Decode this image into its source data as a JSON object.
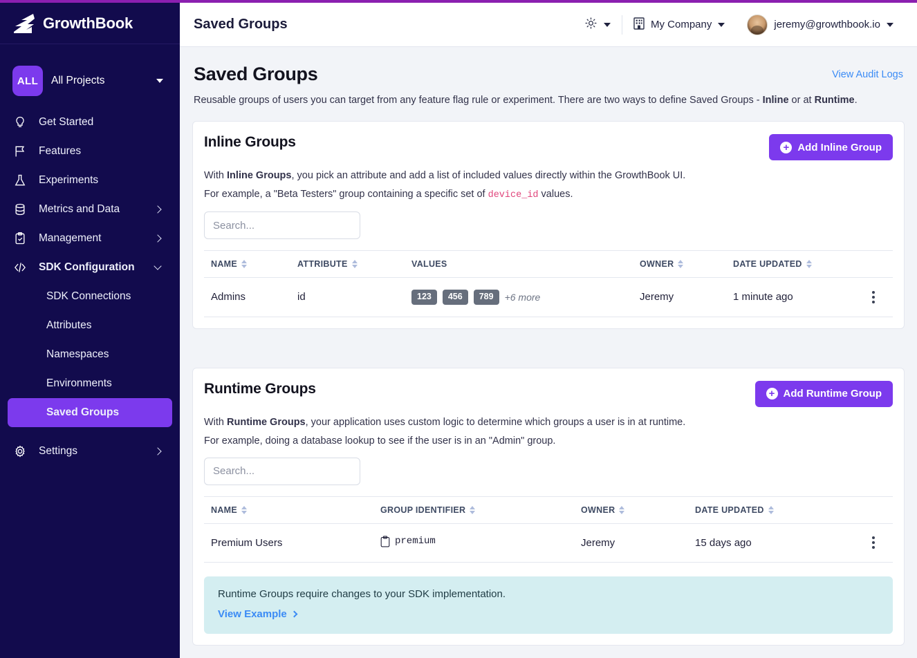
{
  "brand": {
    "name": "GrowthBook",
    "logo_icon": "growthbook-logo-icon"
  },
  "sidebar": {
    "project": {
      "badge": "ALL",
      "label": "All Projects",
      "caret_icon": "caret-down-icon"
    },
    "items": [
      {
        "label": "Get Started",
        "icon": "lightbulb-icon",
        "expandable": false
      },
      {
        "label": "Features",
        "icon": "flag-icon",
        "expandable": false
      },
      {
        "label": "Experiments",
        "icon": "flask-icon",
        "expandable": false
      },
      {
        "label": "Metrics and Data",
        "icon": "database-icon",
        "expandable": true
      },
      {
        "label": "Management",
        "icon": "clipboard-check-icon",
        "expandable": true
      },
      {
        "label": "SDK Configuration",
        "icon": "code-brackets-icon",
        "expandable": true,
        "expanded": true
      }
    ],
    "sub_items": [
      {
        "label": "SDK Connections",
        "active": false
      },
      {
        "label": "Attributes",
        "active": false
      },
      {
        "label": "Namespaces",
        "active": false
      },
      {
        "label": "Environments",
        "active": false
      },
      {
        "label": "Saved Groups",
        "active": true
      }
    ],
    "settings": {
      "label": "Settings",
      "icon": "gear-icon",
      "expandable": true
    }
  },
  "topbar": {
    "title": "Saved Groups",
    "theme_toggle": "sun-icon",
    "org": {
      "label": "My Company",
      "icon": "building-icon"
    },
    "user": {
      "email": "jeremy@growthbook.io",
      "avatar": "user-avatar"
    }
  },
  "page": {
    "title": "Saved Groups",
    "audit_link": "View Audit Logs",
    "description_parts": {
      "p1": "Reusable groups of users you can target from any feature flag rule or experiment. There are two ways to define Saved Groups - ",
      "b1": "Inline",
      "p2": " or at ",
      "b2": "Runtime",
      "p3": "."
    }
  },
  "inline_groups": {
    "title": "Inline Groups",
    "add_button": "Add Inline Group",
    "desc1_parts": {
      "a": "With ",
      "b": "Inline Groups",
      "c": ", you pick an attribute and add a list of included values directly within the GrowthBook UI."
    },
    "desc2_parts": {
      "a": "For example, a \"Beta Testers\" group containing a specific set of ",
      "code": "device_id",
      "c": " values."
    },
    "search_placeholder": "Search...",
    "search_value": "",
    "columns": [
      "NAME",
      "ATTRIBUTE",
      "VALUES",
      "OWNER",
      "DATE UPDATED"
    ],
    "rows": [
      {
        "name": "Admins",
        "attribute": "id",
        "values": [
          "123",
          "456",
          "789"
        ],
        "values_more": "+6 more",
        "owner": "Jeremy",
        "date_updated": "1 minute ago",
        "menu_icon": "kebab-menu-icon"
      }
    ]
  },
  "runtime_groups": {
    "title": "Runtime Groups",
    "add_button": "Add Runtime Group",
    "desc1_parts": {
      "a": "With ",
      "b": "Runtime Groups",
      "c": ", your application uses custom logic to determine which groups a user is in at runtime."
    },
    "desc2_parts": {
      "a": "For example, doing a database lookup to see if the user is in an \"Admin\" group.",
      "code": "",
      "c": ""
    },
    "search_placeholder": "Search...",
    "search_value": "",
    "columns": [
      "NAME",
      "GROUP IDENTIFIER",
      "OWNER",
      "DATE UPDATED"
    ],
    "rows": [
      {
        "name": "Premium Users",
        "identifier": "premium",
        "identifier_icon": "clipboard-copy-icon",
        "owner": "Jeremy",
        "date_updated": "15 days ago",
        "menu_icon": "kebab-menu-icon"
      }
    ],
    "callout": {
      "text": "Runtime Groups require changes to your SDK implementation.",
      "link": "View Example",
      "link_icon": "chevron-right-icon"
    }
  },
  "colors": {
    "brand_purple": "#7c3aed",
    "sidebar_navy": "#120b4d",
    "top_strip": "#8b1fb0",
    "link_blue": "#3b8bf5",
    "badge_gray": "#666e7c",
    "callout_teal": "#d4eef1",
    "code_pink": "#e0457b",
    "page_bg": "#f2f4f8"
  }
}
